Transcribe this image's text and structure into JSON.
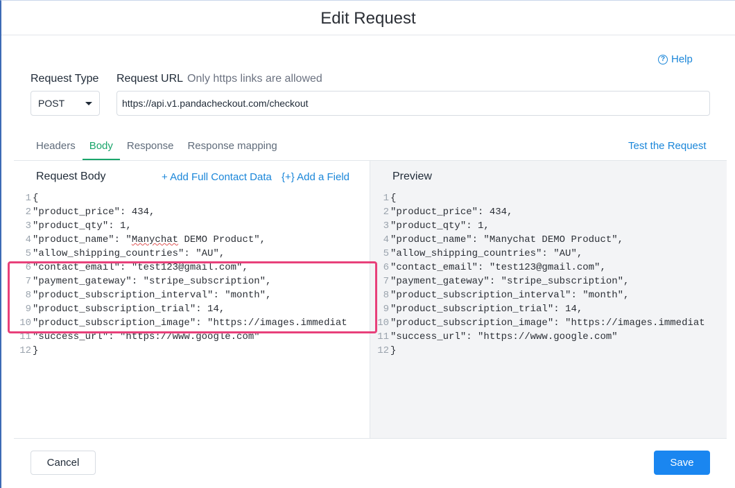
{
  "modal": {
    "title": "Edit Request",
    "help_label": "Help"
  },
  "request_type": {
    "label": "Request Type",
    "value": "POST"
  },
  "request_url": {
    "label": "Request URL",
    "note": "Only https links are allowed",
    "value": "https://api.v1.pandacheckout.com/checkout"
  },
  "tabs": [
    {
      "label": "Headers",
      "active": false
    },
    {
      "label": "Body",
      "active": true
    },
    {
      "label": "Response",
      "active": false
    },
    {
      "label": "Response mapping",
      "active": false
    }
  ],
  "test_request_label": "Test the Request",
  "request_body": {
    "title": "Request Body",
    "add_contact_label": "+ Add Full Contact Data",
    "add_field_label": "{+} Add a Field",
    "lines": [
      {
        "n": "1",
        "t": "{"
      },
      {
        "n": "2",
        "t": "\"product_price\": 434,"
      },
      {
        "n": "3",
        "t": "\"product_qty\": 1,"
      },
      {
        "n": "4",
        "t": "\"product_name\": \"Manychat DEMO Product\","
      },
      {
        "n": "5",
        "t": "\"allow_shipping_countries\": \"AU\","
      },
      {
        "n": "6",
        "t": "\"contact_email\": \"test123@gmail.com\","
      },
      {
        "n": "7",
        "t": "\"payment_gateway\": \"stripe_subscription\","
      },
      {
        "n": "8",
        "t": "\"product_subscription_interval\": \"month\","
      },
      {
        "n": "9",
        "t": "\"product_subscription_trial\": 14,"
      },
      {
        "n": "10",
        "t": "\"product_subscription_image\": \"https://images.immediat"
      },
      {
        "n": "11",
        "t": "\"success_url\": \"https://www.google.com\""
      },
      {
        "n": "12",
        "t": "}"
      }
    ]
  },
  "preview": {
    "title": "Preview",
    "lines": [
      {
        "n": "1",
        "t": "{"
      },
      {
        "n": "2",
        "t": "\"product_price\": 434,"
      },
      {
        "n": "3",
        "t": "\"product_qty\": 1,"
      },
      {
        "n": "4",
        "t": "\"product_name\": \"Manychat DEMO Product\","
      },
      {
        "n": "5",
        "t": "\"allow_shipping_countries\": \"AU\","
      },
      {
        "n": "6",
        "t": "\"contact_email\": \"test123@gmail.com\","
      },
      {
        "n": "7",
        "t": "\"payment_gateway\": \"stripe_subscription\","
      },
      {
        "n": "8",
        "t": "\"product_subscription_interval\": \"month\","
      },
      {
        "n": "9",
        "t": "\"product_subscription_trial\": 14,"
      },
      {
        "n": "10",
        "t": "\"product_subscription_image\": \"https://images.immediat"
      },
      {
        "n": "11",
        "t": "\"success_url\": \"https://www.google.com\""
      },
      {
        "n": "12",
        "t": "}"
      }
    ]
  },
  "footer": {
    "cancel_label": "Cancel",
    "save_label": "Save"
  },
  "colors": {
    "accent_blue": "#1a86d9",
    "active_tab_green": "#1aa56b",
    "save_button": "#1a86f0",
    "highlight_box": "#e8407a"
  }
}
